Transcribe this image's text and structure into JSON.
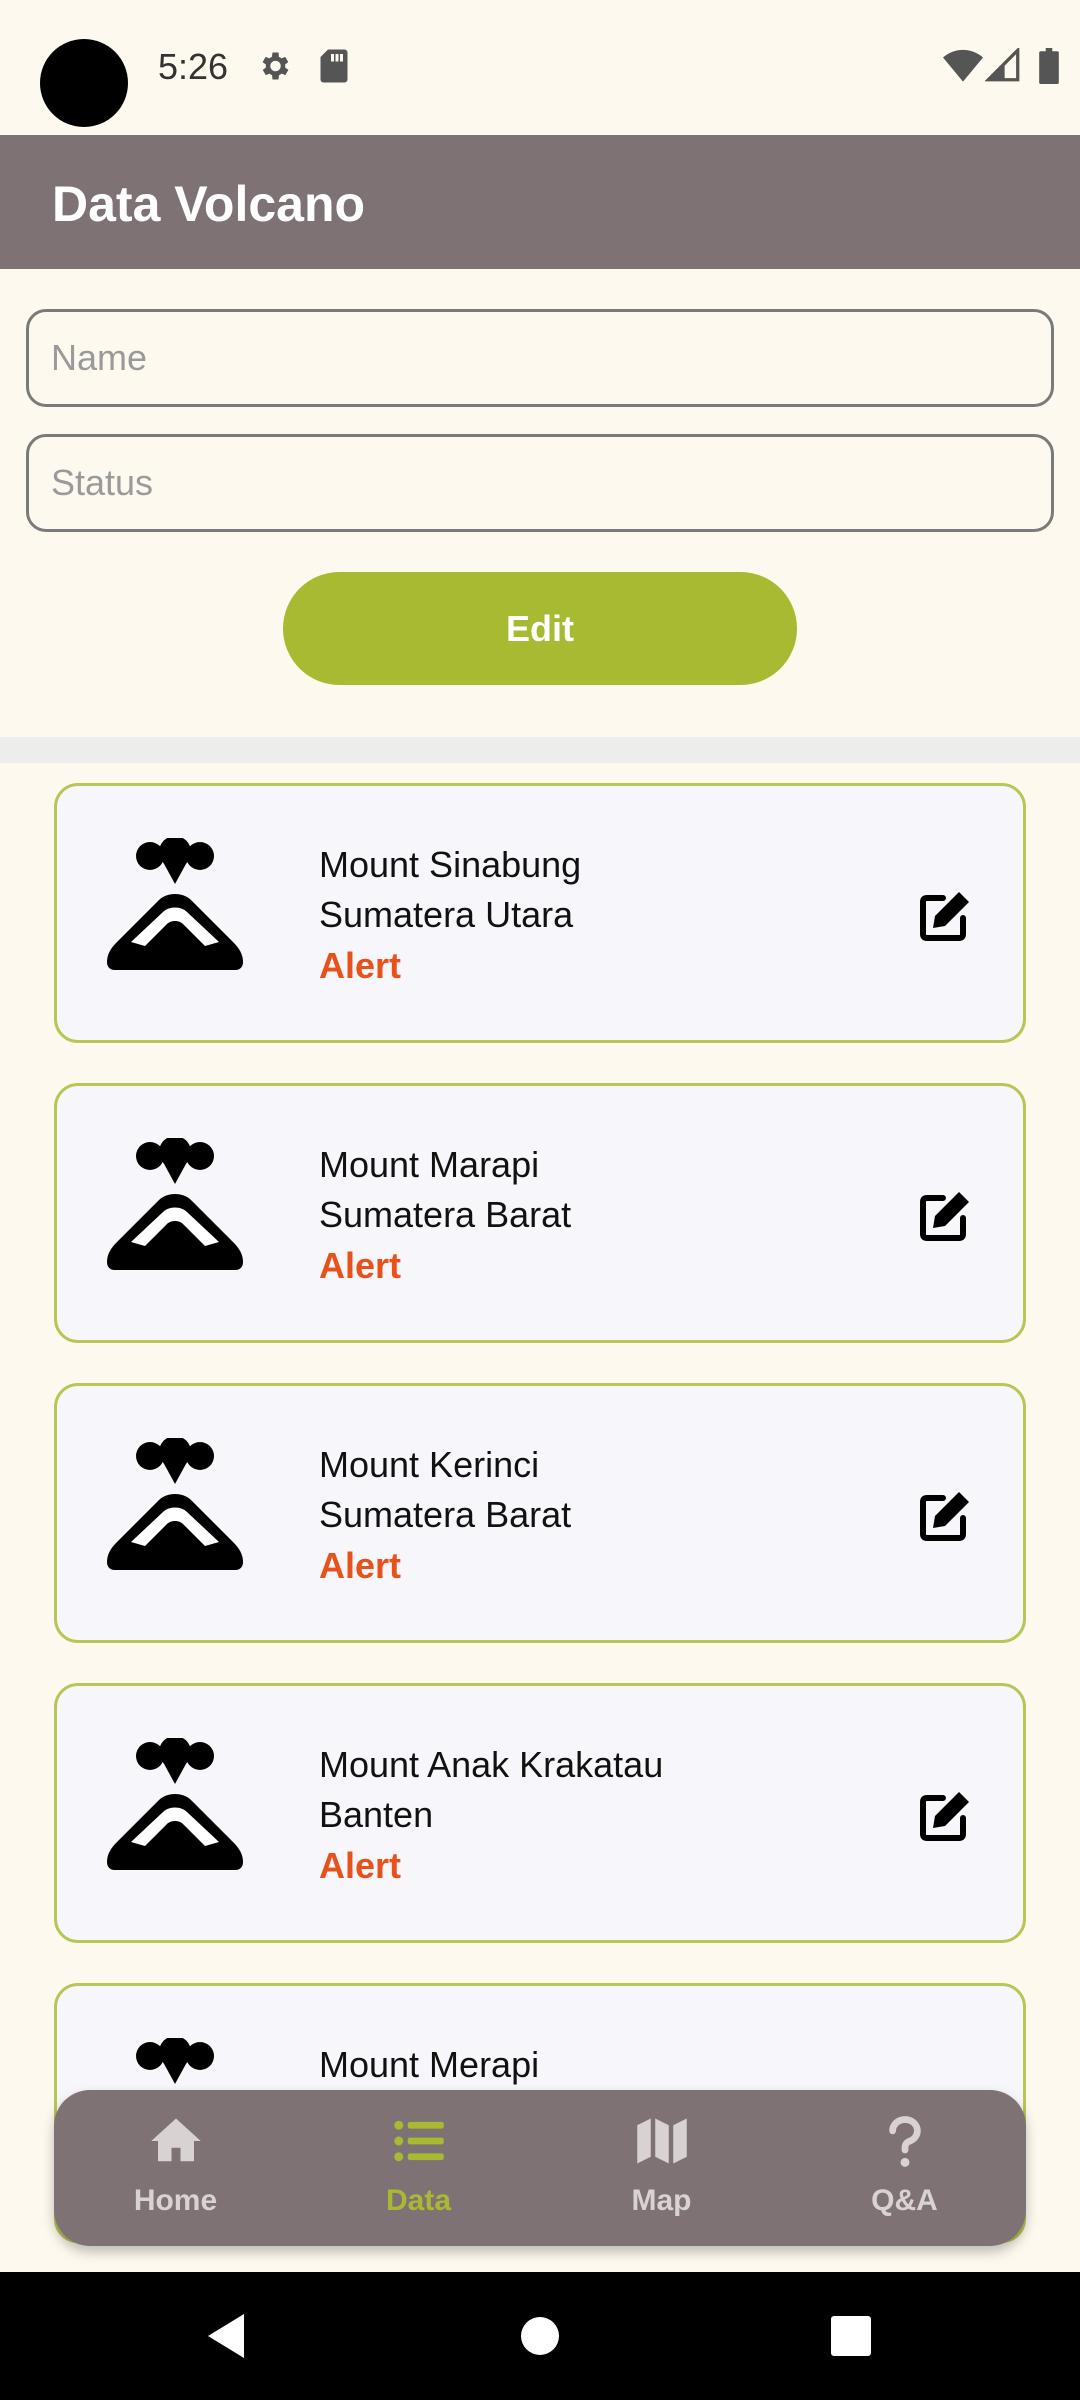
{
  "status_bar": {
    "time": "5:26"
  },
  "app_bar": {
    "title": "Data Volcano"
  },
  "form": {
    "name_placeholder": "Name",
    "status_placeholder": "Status",
    "edit_label": "Edit"
  },
  "volcanoes": [
    {
      "name": "Mount Sinabung",
      "location": "Sumatera Utara",
      "status": "Alert"
    },
    {
      "name": "Mount Marapi",
      "location": "Sumatera Barat",
      "status": "Alert"
    },
    {
      "name": "Mount Kerinci",
      "location": "Sumatera Barat",
      "status": "Alert"
    },
    {
      "name": "Mount Anak Krakatau",
      "location": "Banten",
      "status": "Alert"
    },
    {
      "name": "Mount Merapi"
    }
  ],
  "bottom_nav": {
    "items": [
      {
        "label": "Home",
        "icon": "home-icon"
      },
      {
        "label": "Data",
        "icon": "list-icon",
        "active": true
      },
      {
        "label": "Map",
        "icon": "map-icon"
      },
      {
        "label": "Q&A",
        "icon": "question-icon"
      }
    ]
  },
  "colors": {
    "background": "#FDF9EE",
    "app_bar": "#7E7275",
    "accent": "#A8B932",
    "alert": "#E9511A",
    "card_border": "#B9C555"
  }
}
